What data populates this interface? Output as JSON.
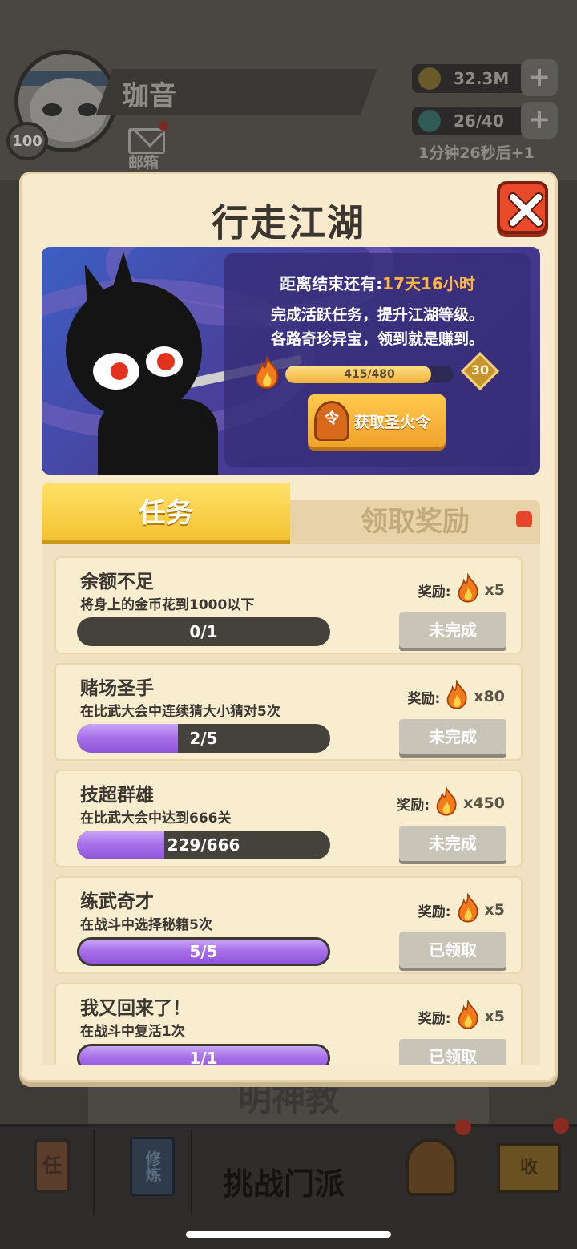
{
  "player": {
    "name": "珈音",
    "level": "100",
    "mail_label": "邮箱"
  },
  "resources": {
    "gold": "32.3M",
    "energy": "26/40",
    "energy_timer": "1分钟26秒后+1",
    "plus": "+"
  },
  "background": {
    "section_title": "明神教",
    "nav": [
      {
        "label": "任",
        "icon": "scroll-icon"
      },
      {
        "label": "修炼",
        "icon": "book-icon"
      },
      {
        "label": "挑战门派",
        "icon": "crossed-swords-icon"
      },
      {
        "label": "",
        "icon": "helmet-icon"
      },
      {
        "label": "收",
        "icon": "house-icon"
      }
    ]
  },
  "modal": {
    "title": "行走江湖",
    "close_icon": "close-icon",
    "banner": {
      "end_prefix": "距离结束还有:",
      "end_time": "17天16小时",
      "desc_line1": "完成活跃任务，提升江湖等级。",
      "desc_line2": "各路奇珍异宝，领到就是赚到。",
      "xp_text": "415/480",
      "xp_progress": 0.865,
      "level": "30",
      "get_button_icon_text": "令",
      "get_button_label": "获取圣火令"
    },
    "tabs": {
      "task": "任务",
      "reward": "领取奖励"
    },
    "reward_prefix": "奖励:",
    "tasks": [
      {
        "title": "余额不足",
        "desc": "将身上的金币花到1000以下",
        "progress_text": "0/1",
        "progress": 0,
        "reward_count": "x5",
        "status": "未完成"
      },
      {
        "title": "赌场圣手",
        "desc": "在比武大会中连续猜大小猜对5次",
        "progress_text": "2/5",
        "progress": 0.4,
        "reward_count": "x80",
        "status": "未完成"
      },
      {
        "title": "技超群雄",
        "desc": "在比武大会中达到666关",
        "progress_text": "229/666",
        "progress": 0.344,
        "reward_count": "x450",
        "status": "未完成"
      },
      {
        "title": "练武奇才",
        "desc": "在战斗中选择秘籍5次",
        "progress_text": "5/5",
        "progress": 1,
        "reward_count": "x5",
        "status": "已领取"
      },
      {
        "title": "我又回来了！",
        "desc": "在战斗中复活1次",
        "progress_text": "1/1",
        "progress": 1,
        "reward_count": "x5",
        "status": "已领取"
      }
    ]
  },
  "colors": {
    "accent_orange": "#ffb640",
    "close_red": "#e84a2a",
    "progress_purple": "#a871ea",
    "tab_yellow": "#f2c230"
  }
}
